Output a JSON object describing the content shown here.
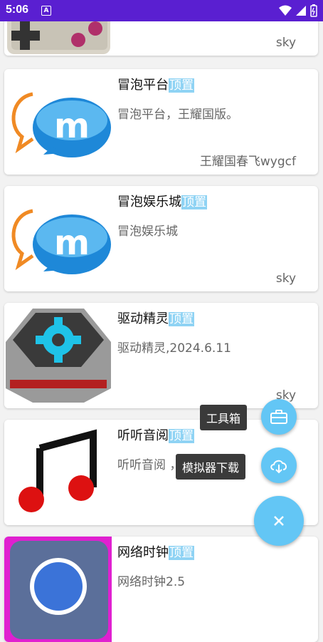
{
  "status_bar": {
    "time": "5:06",
    "app_badge": "A"
  },
  "cards": [
    {
      "title": "",
      "pin": "",
      "desc": "",
      "author": "sky",
      "thumb": "gamepad-icon"
    },
    {
      "title": "冒泡平台",
      "pin": "顶置",
      "desc": "冒泡平台，王耀国版。",
      "author": "王耀国春飞wygcf",
      "thumb": "maopao-logo-icon"
    },
    {
      "title": "冒泡娱乐城",
      "pin": "顶置",
      "desc": "冒泡娱乐城",
      "author": "sky",
      "thumb": "maopao-logo-icon"
    },
    {
      "title": "驱动精灵",
      "pin": "顶置",
      "desc": "驱动精灵,2024.6.11",
      "author": "sky",
      "thumb": "gear-icon"
    },
    {
      "title": "听听音阅",
      "pin": "顶置",
      "desc": "听听音阅 ，更贴心！",
      "author": "",
      "thumb": "music-note-icon"
    },
    {
      "title": "网络时钟",
      "pin": "顶置",
      "desc": "网络时钟2.5",
      "author": "",
      "thumb": "clock-icon"
    }
  ],
  "fab_menu": {
    "toolbox_label": "工具箱",
    "emulator_label": "模拟器下载"
  },
  "colors": {
    "status_bar": "#5a1fd1",
    "fab": "#63c6f5",
    "pin_bg": "#8fd3f4"
  }
}
